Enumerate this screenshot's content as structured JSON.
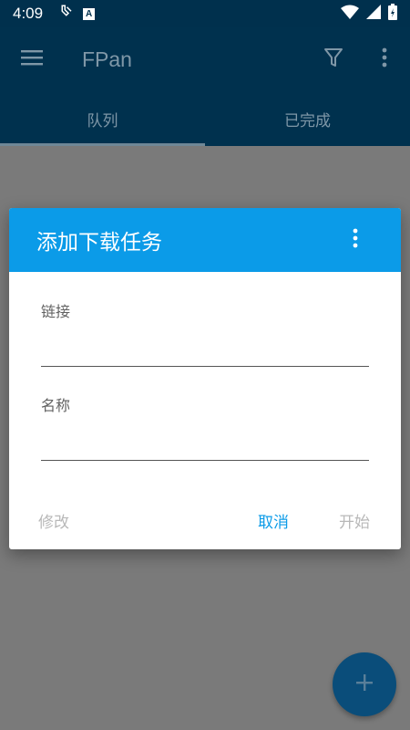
{
  "status_bar": {
    "time": "4:09",
    "badge": "A"
  },
  "app_bar": {
    "title": "FPan"
  },
  "tabs": [
    {
      "label": "队列",
      "active": true
    },
    {
      "label": "已完成",
      "active": false
    }
  ],
  "dialog": {
    "title": "添加下载任务",
    "fields": [
      {
        "label": "链接",
        "value": ""
      },
      {
        "label": "名称",
        "value": ""
      }
    ],
    "actions": {
      "modify": "修改",
      "cancel": "取消",
      "start": "开始"
    }
  },
  "colors": {
    "header": "#00314e",
    "dialog_header": "#0b9be8",
    "accent": "#0b9be8",
    "fab": "#0a4d7a"
  }
}
